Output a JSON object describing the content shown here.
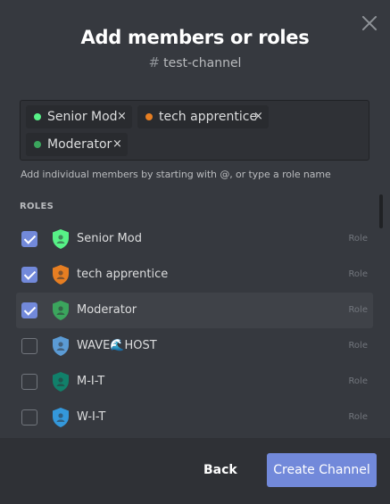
{
  "modal": {
    "title": "Add members or roles",
    "channel_icon": "#",
    "channel_name": "test-channel",
    "close_icon": "close-icon"
  },
  "selected_tags": [
    {
      "label": "Senior Mod",
      "color": "#57f287",
      "remove": "×"
    },
    {
      "label": "tech apprentice",
      "color": "#e67e22",
      "remove": "×"
    },
    {
      "label": "Moderator",
      "color": "#3ba55d",
      "remove": "×"
    }
  ],
  "hint": "Add individual members by starting with @, or type a role name",
  "roles_header": "ROLES",
  "roles": [
    {
      "name": "Senior Mod",
      "type": "Role",
      "checked": true,
      "color": "#57f287"
    },
    {
      "name": "tech apprentice",
      "type": "Role",
      "checked": true,
      "color": "#e67e22"
    },
    {
      "name": "Moderator",
      "type": "Role",
      "checked": true,
      "color": "#3ba55d"
    },
    {
      "name": "WAVE🌊HOST",
      "type": "Role",
      "checked": false,
      "color": "#5b9bd5"
    },
    {
      "name": "M-I-T",
      "type": "Role",
      "checked": false,
      "color": "#11806a"
    },
    {
      "name": "W-I-T",
      "type": "Role",
      "checked": false,
      "color": "#3498db"
    }
  ],
  "footer": {
    "back_label": "Back",
    "create_label": "Create Channel",
    "accent": "#7289da"
  }
}
